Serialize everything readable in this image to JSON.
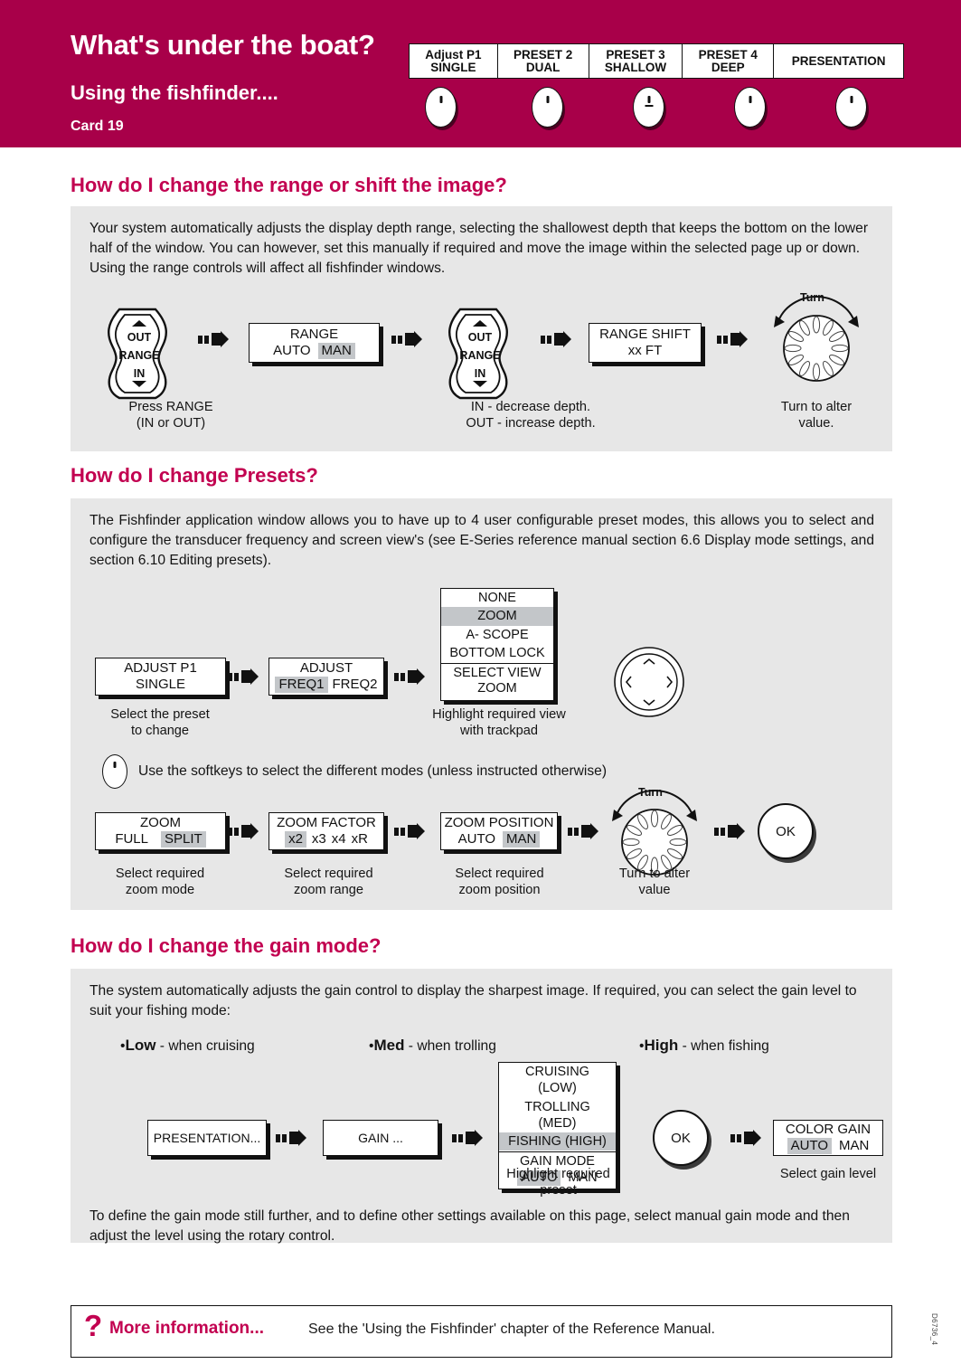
{
  "header": {
    "title": "What's under the boat?",
    "subtitle": "Using the fishfinder....",
    "card": "Card 19",
    "brand_color": "#a80049",
    "softkeys": [
      {
        "line1": "Adjust P1",
        "line2": "SINGLE"
      },
      {
        "line1": "PRESET 2",
        "line2": "DUAL"
      },
      {
        "line1": "PRESET 3",
        "line2": "SHALLOW"
      },
      {
        "line1": "PRESET 4",
        "line2": "DEEP"
      },
      {
        "line1": "PRESENTATION",
        "line2": ""
      }
    ]
  },
  "section_range": {
    "heading": "How do I change the range or shift the image?",
    "body": "Your system automatically adjusts the display depth range, selecting the shallowest depth that keeps the bottom on the lower half of the window. You can however, set this manually if required and move the image within the selected page up or down. Using the range controls will affect all fishfinder windows.",
    "rocker1": {
      "top": "OUT",
      "mid": "RANGE",
      "bottom": "IN"
    },
    "rocker2": {
      "top": "OUT",
      "mid": "RANGE",
      "bottom": "IN"
    },
    "box_range": {
      "title": "RANGE",
      "opt1": "AUTO",
      "opt2": "MAN",
      "selected": "MAN"
    },
    "box_shift": {
      "title": "RANGE SHIFT",
      "value": "xx FT"
    },
    "rotary_label": "Turn",
    "caption1": "Press RANGE\n(IN or OUT)",
    "caption1_l1": "Press RANGE",
    "caption1_l2": "(IN or OUT)",
    "caption2_l1": "IN - decrease depth.",
    "caption2_l2": "OUT - increase depth.",
    "caption3_l1": "Turn to alter",
    "caption3_l2": "value."
  },
  "section_presets": {
    "heading": "How do I change Presets?",
    "body": "The Fishfinder application window allows you to have up to 4 user configurable preset modes, this allows you to select and configure the transducer frequency and screen view's (see E-Series reference manual section 6.6 Display mode settings, and section 6.10 Editing presets).",
    "box_adjust_p1": {
      "line1": "ADJUST P1",
      "line2": "SINGLE"
    },
    "box_adjust_freq": {
      "title": "ADJUST",
      "opt1": "FREQ1",
      "opt2": "FREQ2",
      "selected": "FREQ1"
    },
    "view_menu": {
      "options": [
        "NONE",
        "ZOOM",
        "A- SCOPE",
        "BOTTOM LOCK"
      ],
      "selected": "ZOOM",
      "foot_line1": "SELECT VIEW",
      "foot_line2": "ZOOM"
    },
    "caption_preset_l1": "Select the preset",
    "caption_preset_l2": "to change",
    "caption_view_l1": "Highlight required view",
    "caption_view_l2": "with trackpad",
    "softkey_note": "Use the softkeys to select the different modes (unless instructed otherwise)",
    "box_zoom": {
      "title": "ZOOM",
      "opt1": "FULL",
      "opt2": "SPLIT",
      "selected": "SPLIT"
    },
    "box_zoom_factor": {
      "title": "ZOOM FACTOR",
      "options": [
        "x2",
        "x3",
        "x4",
        "xR"
      ],
      "selected": "x2"
    },
    "box_zoom_position": {
      "title": "ZOOM POSITION",
      "opt1": "AUTO",
      "opt2": "MAN",
      "selected": "MAN"
    },
    "rotary_label": "Turn",
    "ok_label": "OK",
    "caption_zoom_mode_l1": "Select required",
    "caption_zoom_mode_l2": "zoom mode",
    "caption_zoom_range_l1": "Select required",
    "caption_zoom_range_l2": "zoom range",
    "caption_zoom_pos_l1": "Select required",
    "caption_zoom_pos_l2": "zoom position",
    "caption_turn_l1": "Turn to alter",
    "caption_turn_l2": "value"
  },
  "section_gain": {
    "heading": "How do I change the gain mode?",
    "body": "The system automatically adjusts the gain control to display the sharpest image.  If required, you can select the gain level to suit your fishing mode:",
    "bullets": [
      {
        "bullet": "•",
        "term": "Low",
        "desc": " - when cruising"
      },
      {
        "bullet": "•",
        "term": "Med",
        "desc": " - when trolling"
      },
      {
        "bullet": "•",
        "term": "High",
        "desc": " - when fishing"
      }
    ],
    "box_presentation": "PRESENTATION...",
    "box_gain": "GAIN ...",
    "gain_menu": {
      "options": [
        "CRUISING (LOW)",
        "TROLLING (MED)",
        "FISHING (HIGH)"
      ],
      "selected": "FISHING (HIGH)",
      "foot_title": "GAIN MODE",
      "foot_opt1": "AUTO",
      "foot_opt2": "MAN",
      "foot_selected": "AUTO"
    },
    "ok_label": "OK",
    "box_color_gain": {
      "title": "COLOR GAIN",
      "opt1": "AUTO",
      "opt2": "MAN",
      "selected": "AUTO"
    },
    "caption_preset_l1": "Highlight required",
    "caption_preset_l2": "preset",
    "caption_gain_level": "Select gain level",
    "footer_body": "To define the gain mode still further, and to define other settings available on this page, select manual gain mode and then adjust the level using the rotary control."
  },
  "footer": {
    "question_mark": "?",
    "title": "More information...",
    "body": "See the 'Using the Fishfinder' chapter of the Reference Manual.",
    "doc_code": "D6736_4"
  }
}
